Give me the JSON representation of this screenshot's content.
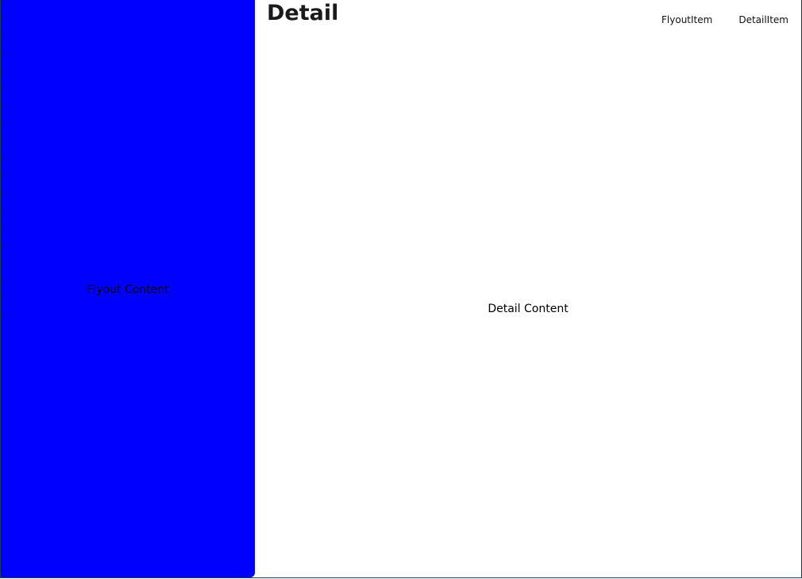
{
  "colors": {
    "flyout_background": "#0000ff",
    "detail_background": "#ffffff",
    "window_border": "#1f3a52"
  },
  "flyout": {
    "content_label": "Flyout Content"
  },
  "detail": {
    "title": "Detail",
    "content_label": "Detail Content"
  },
  "toolbar": {
    "items": [
      {
        "label": "FlyoutItem"
      },
      {
        "label": "DetailItem"
      }
    ]
  }
}
